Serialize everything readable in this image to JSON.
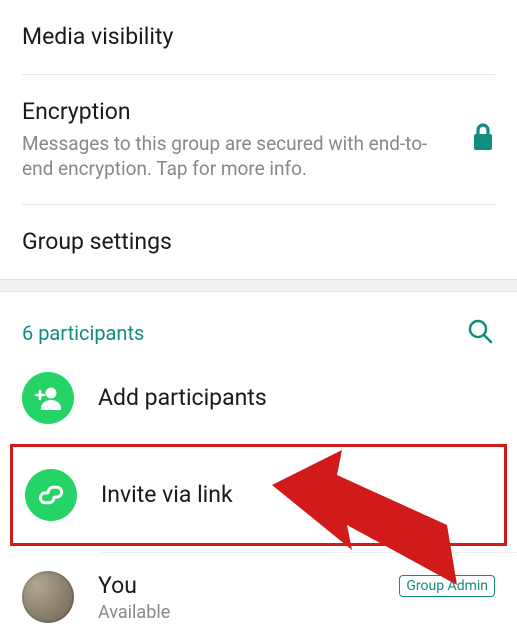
{
  "settings": {
    "media_visibility": {
      "title": "Media visibility"
    },
    "encryption": {
      "title": "Encryption",
      "description": "Messages to this group are secured with end-to-end encryption. Tap for more info."
    },
    "group_settings": {
      "title": "Group settings"
    }
  },
  "participants": {
    "count_label": "6 participants",
    "add_label": "Add participants",
    "invite_label": "Invite via link",
    "you": {
      "name": "You",
      "status": "Available",
      "badge": "Group Admin"
    }
  },
  "colors": {
    "accent": "#128C7E",
    "green": "#25D366",
    "highlight": "#d11a1a"
  }
}
